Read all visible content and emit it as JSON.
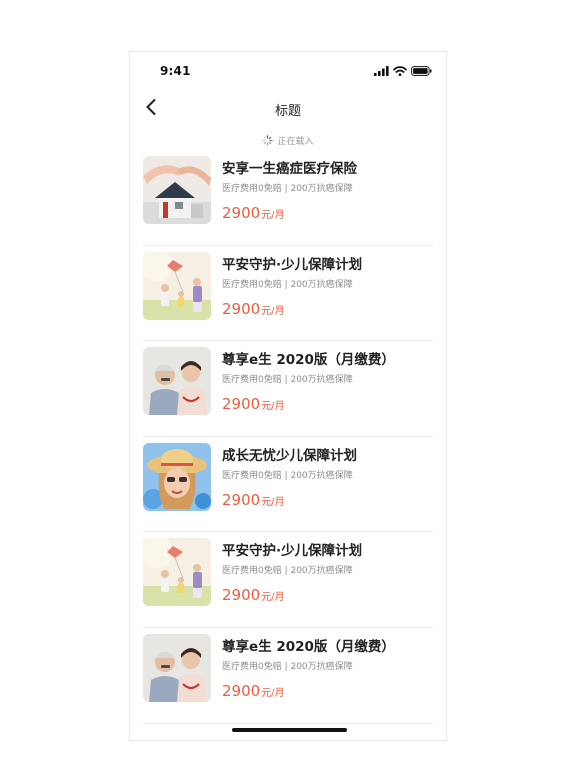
{
  "status_bar": {
    "time": "9:41"
  },
  "nav": {
    "title": "标题"
  },
  "loading": {
    "text": "正在载入"
  },
  "products": [
    {
      "title": "安享一生癌症医疗保险",
      "subtitle": "医疗费用0免赔 | 200万抗癌保障",
      "price": "2900",
      "unit": "元/月",
      "image": "house-hands-image"
    },
    {
      "title": "平安守护·少儿保障计划",
      "subtitle": "医疗费用0免赔 | 200万抗癌保障",
      "price": "2900",
      "unit": "元/月",
      "image": "family-kite-image"
    },
    {
      "title": "尊享e生 2020版（月缴费）",
      "subtitle": "医疗费用0免赔 | 200万抗癌保障",
      "price": "2900",
      "unit": "元/月",
      "image": "elderly-couple-image"
    },
    {
      "title": "成长无忧少儿保障计划",
      "subtitle": "医疗费用0免赔 | 200万抗癌保障",
      "price": "2900",
      "unit": "元/月",
      "image": "girl-sunhat-image"
    },
    {
      "title": "平安守护·少儿保障计划",
      "subtitle": "医疗费用0免赔 | 200万抗癌保障",
      "price": "2900",
      "unit": "元/月",
      "image": "family-kite-image"
    },
    {
      "title": "尊享e生 2020版（月缴费）",
      "subtitle": "医疗费用0免赔 | 200万抗癌保障",
      "price": "2900",
      "unit": "元/月",
      "image": "elderly-couple-image"
    }
  ],
  "colors": {
    "price": "#ef5b3f",
    "divider": "#ececec"
  }
}
